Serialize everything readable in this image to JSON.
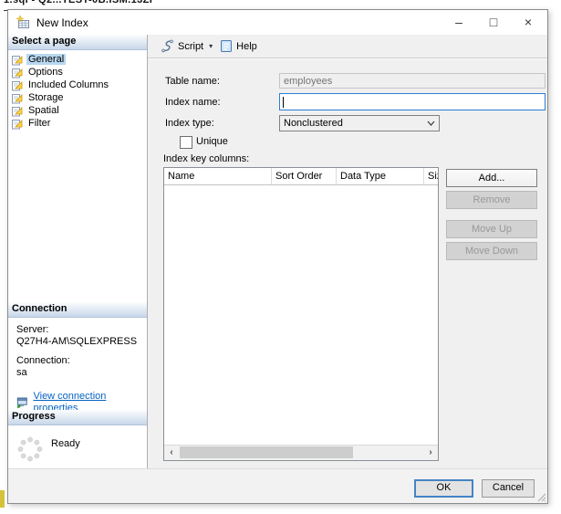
{
  "background_window": {
    "title_fragment": "1.sql - Q2...TEST-0B.ISM.13ZI"
  },
  "dialog": {
    "title": "New Index",
    "icons": {
      "minimize": "–",
      "maximize": "□",
      "close": "×",
      "script_dropdown": "▾",
      "scroll_left": "‹",
      "scroll_right": "›"
    },
    "sidebar": {
      "header": "Select a page",
      "pages": [
        {
          "label": "General",
          "selected": true
        },
        {
          "label": "Options",
          "selected": false
        },
        {
          "label": "Included Columns",
          "selected": false
        },
        {
          "label": "Storage",
          "selected": false
        },
        {
          "label": "Spatial",
          "selected": false
        },
        {
          "label": "Filter",
          "selected": false
        }
      ],
      "connection": {
        "header": "Connection",
        "server_label": "Server:",
        "server_value": "Q27H4-AM\\SQLEXPRESS",
        "connection_label": "Connection:",
        "connection_value": "sa",
        "link_label": "View connection properties"
      },
      "progress": {
        "header": "Progress",
        "status": "Ready"
      }
    },
    "toolbar": {
      "script_label": "Script",
      "help_label": "Help"
    },
    "form": {
      "table_name": {
        "label": "Table name:",
        "value": "employees",
        "disabled": true
      },
      "index_name": {
        "label": "Index name:",
        "value": "",
        "focused": true
      },
      "index_type": {
        "label": "Index type:",
        "value": "Nonclustered"
      },
      "unique": {
        "label": "Unique",
        "checked": false
      },
      "index_key_columns_label": "Index key columns:",
      "grid": {
        "columns": [
          "Name",
          "Sort Order",
          "Data Type",
          "Size"
        ],
        "rows": []
      },
      "grid_buttons": [
        {
          "label": "Add...",
          "enabled": true
        },
        {
          "label": "Remove",
          "enabled": false
        },
        {
          "label": "Move Up",
          "enabled": false
        },
        {
          "label": "Move Down",
          "enabled": false
        }
      ]
    },
    "footer": {
      "ok_label": "OK",
      "cancel_label": "Cancel"
    }
  },
  "colors": {
    "accent_focus": "#2a7fd4",
    "ok_border": "#4584c4",
    "link": "#0563c1",
    "selected_page_bg": "#b8d7f0",
    "section_header_gradient_top": "#fcfdfe",
    "section_header_gradient_bottom": "#c7d7ea",
    "dialog_bg": "#f0f0f0",
    "disabled_button_bg": "#d2d2d2",
    "disabled_text": "#989898"
  }
}
